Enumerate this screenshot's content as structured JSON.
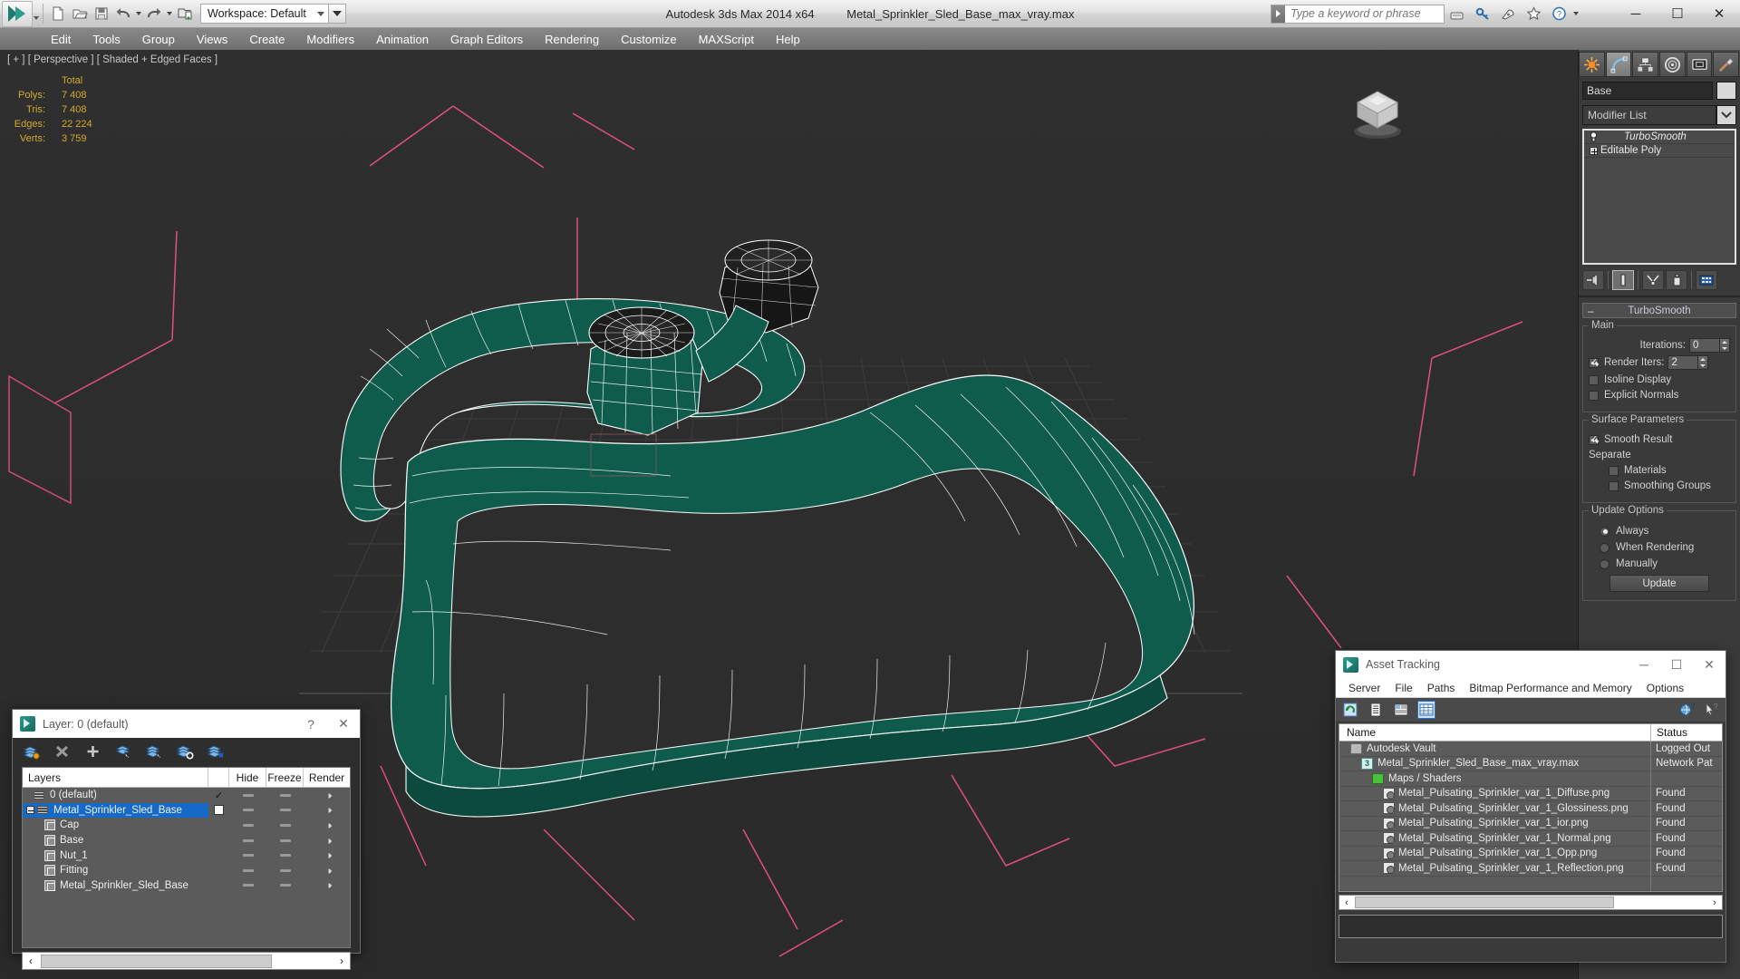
{
  "titlebar": {
    "app_title": "Autodesk 3ds Max  2014 x64",
    "file_title": "Metal_Sprinkler_Sled_Base_max_vray.max",
    "workspace_label": "Workspace: Default",
    "search_placeholder": "Type a keyword or phrase",
    "quick_access": [
      {
        "name": "new-file-icon",
        "label": "New"
      },
      {
        "name": "open-file-icon",
        "label": "Open"
      },
      {
        "name": "save-file-icon",
        "label": "Save"
      },
      {
        "name": "undo-icon",
        "label": "Undo"
      },
      {
        "name": "redo-icon",
        "label": "Redo"
      },
      {
        "name": "project-folder-icon",
        "label": "Set Project Folder"
      }
    ],
    "right_icons": [
      {
        "name": "autodesk-360-icon",
        "label": "Autodesk 360"
      },
      {
        "name": "key-icon",
        "label": "Sign In"
      },
      {
        "name": "satellite-icon",
        "label": "Communication Center"
      },
      {
        "name": "star-favorites-icon",
        "label": "Favorites"
      },
      {
        "name": "help-question-icon",
        "label": "Help"
      }
    ],
    "window_buttons": {
      "minimize": "─",
      "maximize": "☐",
      "close": "✕"
    }
  },
  "menubar": {
    "items": [
      "Edit",
      "Tools",
      "Group",
      "Views",
      "Create",
      "Modifiers",
      "Animation",
      "Graph Editors",
      "Rendering",
      "Customize",
      "MAXScript",
      "Help"
    ]
  },
  "viewport": {
    "label": "[ + ] [ Perspective ] [ Shaded + Edged Faces ]",
    "stats": {
      "header": "Total",
      "rows": [
        {
          "label": "Polys:",
          "value": "7 408"
        },
        {
          "label": "Tris:",
          "value": "7 408"
        },
        {
          "label": "Edges:",
          "value": "22 224"
        },
        {
          "label": "Verts:",
          "value": "3 759"
        }
      ]
    },
    "colors": {
      "background": "#2d2d2d",
      "mesh_fill": "#0f5c4d",
      "wireframe": "#ffffff",
      "grid": "#3c3c3c",
      "helper_line": "#e0507d",
      "stats_text": "#d6a92b"
    }
  },
  "command_panel": {
    "tabs": [
      {
        "name": "create-tab",
        "icon": "star-burst-icon",
        "active": false
      },
      {
        "name": "modify-tab",
        "icon": "bent-curve-icon",
        "active": true
      },
      {
        "name": "hierarchy-tab",
        "icon": "hierarchy-tree-icon",
        "active": false
      },
      {
        "name": "motion-tab",
        "icon": "motion-wheel-icon",
        "active": false
      },
      {
        "name": "display-tab",
        "icon": "display-monitor-icon",
        "active": false
      },
      {
        "name": "utilities-tab",
        "icon": "hammer-icon",
        "active": false
      }
    ],
    "object_name": "Base",
    "modifier_list_label": "Modifier List",
    "modifier_stack": [
      {
        "label": "TurboSmooth",
        "italic": true,
        "icon": "lightbulb-icon"
      },
      {
        "label": "Editable Poly",
        "italic": false,
        "icon": "plus-box-icon"
      }
    ],
    "stack_buttons": [
      {
        "name": "pin-stack-button",
        "icon": "pin-icon"
      },
      {
        "name": "show-end-result-button",
        "icon": "show-end-result-icon",
        "active": true
      },
      {
        "name": "make-unique-button",
        "icon": "make-unique-icon"
      },
      {
        "name": "remove-modifier-button",
        "icon": "trash-icon"
      },
      {
        "name": "configure-modifier-sets-button",
        "icon": "configure-sets-icon"
      }
    ],
    "rollout": {
      "title": "TurboSmooth",
      "main_group": "Main",
      "iterations_label": "Iterations:",
      "iterations_value": "0",
      "render_iters_label": "Render Iters:",
      "render_iters_value": "2",
      "render_iters_checked": true,
      "isoline_display": "Isoline Display",
      "isoline_checked": false,
      "explicit_normals": "Explicit Normals",
      "explicit_checked": false,
      "surface_group": "Surface Parameters",
      "smooth_result": "Smooth Result",
      "smooth_result_checked": true,
      "separate_label": "Separate",
      "materials": "Materials",
      "materials_checked": false,
      "smoothing_groups": "Smoothing Groups",
      "smoothing_groups_checked": false,
      "update_group": "Update Options",
      "update_options": [
        {
          "label": "Always",
          "selected": true
        },
        {
          "label": "When Rendering",
          "selected": false
        },
        {
          "label": "Manually",
          "selected": false
        }
      ],
      "update_button": "Update"
    }
  },
  "layers_dialog": {
    "title": "Layer: 0 (default)",
    "help_button": "?",
    "close_button": "✕",
    "toolbar": [
      {
        "name": "create-new-layer-icon"
      },
      {
        "name": "delete-layer-icon"
      },
      {
        "name": "add-selection-to-layer-icon"
      },
      {
        "name": "select-objects-in-layer-icon"
      },
      {
        "name": "highlight-selected-objects-icon"
      },
      {
        "name": "select-highlight-icon"
      },
      {
        "name": "hide-unhide-layer-icon"
      }
    ],
    "columns": [
      "Layers",
      "",
      "Hide",
      "Freeze",
      "Render"
    ],
    "rows": [
      {
        "name": "0 (default)",
        "indent": 1,
        "icon": "layer-icon",
        "current": true,
        "selected": false,
        "expandable": false
      },
      {
        "name": "Metal_Sprinkler_Sled_Base",
        "indent": 0,
        "icon": "layer-icon",
        "current": false,
        "selected": true,
        "expandable": true,
        "checkbox": true
      },
      {
        "name": "Cap",
        "indent": 2,
        "icon": "object-icon",
        "current": false,
        "selected": false,
        "expandable": false
      },
      {
        "name": "Base",
        "indent": 2,
        "icon": "object-icon",
        "current": false,
        "selected": false,
        "expandable": false
      },
      {
        "name": "Nut_1",
        "indent": 2,
        "icon": "object-icon",
        "current": false,
        "selected": false,
        "expandable": false
      },
      {
        "name": "Fitting",
        "indent": 2,
        "icon": "object-icon",
        "current": false,
        "selected": false,
        "expandable": false
      },
      {
        "name": "Metal_Sprinkler_Sled_Base",
        "indent": 2,
        "icon": "object-icon",
        "current": false,
        "selected": false,
        "expandable": false
      }
    ],
    "scroll_left": "‹",
    "scroll_right": "›"
  },
  "asset_tracking": {
    "title": "Asset Tracking",
    "window_buttons": {
      "minimize": "─",
      "maximize": "☐",
      "close": "✕"
    },
    "menu": [
      "Server",
      "File",
      "Paths",
      "Bitmap Performance and Memory",
      "Options"
    ],
    "toolbar": [
      {
        "name": "refresh-icon",
        "active": false
      },
      {
        "name": "list-view-icon",
        "active": false
      },
      {
        "name": "detail-view-icon",
        "active": false
      },
      {
        "name": "grid-view-icon",
        "active": true
      }
    ],
    "right_toolbar": [
      {
        "name": "help-globe-icon"
      },
      {
        "name": "help-pointer-icon"
      }
    ],
    "columns": [
      "Name",
      "Status"
    ],
    "rows": [
      {
        "name": "Autodesk Vault",
        "status": "Logged Out",
        "indent": 1,
        "icon": "vault-icon"
      },
      {
        "name": "Metal_Sprinkler_Sled_Base_max_vray.max",
        "status": "Network Pat",
        "indent": 2,
        "icon": "max-file-icon"
      },
      {
        "name": "Maps / Shaders",
        "status": "",
        "indent": 3,
        "icon": "maps-icon"
      },
      {
        "name": "Metal_Pulsating_Sprinkler_var_1_Diffuse.png",
        "status": "Found",
        "indent": 4,
        "icon": "bitmap-icon"
      },
      {
        "name": "Metal_Pulsating_Sprinkler_var_1_Glossiness.png",
        "status": "Found",
        "indent": 4,
        "icon": "bitmap-icon"
      },
      {
        "name": "Metal_Pulsating_Sprinkler_var_1_ior.png",
        "status": "Found",
        "indent": 4,
        "icon": "bitmap-icon"
      },
      {
        "name": "Metal_Pulsating_Sprinkler_var_1_Normal.png",
        "status": "Found",
        "indent": 4,
        "icon": "bitmap-icon"
      },
      {
        "name": "Metal_Pulsating_Sprinkler_var_1_Opp.png",
        "status": "Found",
        "indent": 4,
        "icon": "bitmap-icon"
      },
      {
        "name": "Metal_Pulsating_Sprinkler_var_1_Reflection.png",
        "status": "Found",
        "indent": 4,
        "icon": "bitmap-icon"
      }
    ],
    "scroll_left": "‹",
    "scroll_right": "›"
  }
}
